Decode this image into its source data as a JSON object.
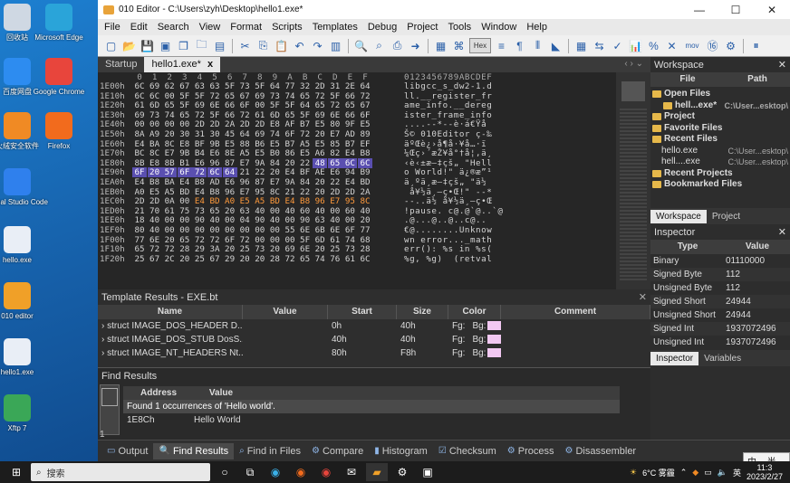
{
  "desktop": {
    "icons": [
      {
        "label": "回收站",
        "color": "#cfd8e3"
      },
      {
        "label": "Microsoft Edge",
        "color": "#2aa4d9"
      },
      {
        "label": "百度网盘",
        "color": "#2d8cf0"
      },
      {
        "label": "Google Chrome",
        "color": "#e8453c"
      },
      {
        "label": "火绒安全软件",
        "color": "#f08a24"
      },
      {
        "label": "Firefox",
        "color": "#f26b1d"
      },
      {
        "label": "Visual Studio Code",
        "color": "#2f80ed"
      },
      {
        "label": "hello.exe",
        "color": "#e9eef6"
      },
      {
        "label": "010 editor",
        "color": "#f0a028"
      },
      {
        "label": "hello1.exe",
        "color": "#e9eef6"
      },
      {
        "label": "Xftp 7",
        "color": "#3aa757"
      }
    ]
  },
  "window": {
    "title": "010 Editor - C:\\Users\\zyh\\Desktop\\hello1.exe*",
    "controls": [
      "—",
      "☐",
      "✕"
    ]
  },
  "menu": [
    "File",
    "Edit",
    "Search",
    "View",
    "Format",
    "Scripts",
    "Templates",
    "Debug",
    "Project",
    "Tools",
    "Window",
    "Help"
  ],
  "toolbar": {
    "hex_label": "Hex",
    "mov_label": "mov"
  },
  "tabs": {
    "startup": "Startup",
    "file": "hello1.exe*",
    "close": "x",
    "nav": "‹ ›  ⌄"
  },
  "hex": {
    "columns": [
      "0",
      "1",
      "2",
      "3",
      "4",
      "5",
      "6",
      "7",
      "8",
      "9",
      "A",
      "B",
      "C",
      "D",
      "E",
      "F"
    ],
    "ascii_header": "0123456789ABCDEF",
    "rows": [
      {
        "addr": "1E00h",
        "bytes": [
          "6C",
          "69",
          "62",
          "67",
          "63",
          "63",
          "5F",
          "73",
          "5F",
          "64",
          "77",
          "32",
          "2D",
          "31",
          "2E",
          "64"
        ],
        "ascii": "libgcc_s_dw2-1.d"
      },
      {
        "addr": "1E10h",
        "bytes": [
          "6C",
          "6C",
          "00",
          "5F",
          "5F",
          "72",
          "65",
          "67",
          "69",
          "73",
          "74",
          "65",
          "72",
          "5F",
          "66",
          "72"
        ],
        "ascii": "ll.__register_fr"
      },
      {
        "addr": "1E20h",
        "bytes": [
          "61",
          "6D",
          "65",
          "5F",
          "69",
          "6E",
          "66",
          "6F",
          "00",
          "5F",
          "5F",
          "64",
          "65",
          "72",
          "65",
          "67"
        ],
        "ascii": "ame_info.__dereg"
      },
      {
        "addr": "1E30h",
        "bytes": [
          "69",
          "73",
          "74",
          "65",
          "72",
          "5F",
          "66",
          "72",
          "61",
          "6D",
          "65",
          "5F",
          "69",
          "6E",
          "66",
          "6F"
        ],
        "ascii": "ister_frame_info"
      },
      {
        "addr": "1E40h",
        "bytes": [
          "00",
          "00",
          "00",
          "00",
          "2D",
          "2D",
          "2A",
          "2D",
          "2D",
          "E8",
          "AF",
          "B7",
          "E5",
          "80",
          "9F",
          "E5"
        ],
        "ascii": "....--*--è·á€Ÿå"
      },
      {
        "addr": "1E50h",
        "bytes": [
          "8A",
          "A9",
          "20",
          "30",
          "31",
          "30",
          "45",
          "64",
          "69",
          "74",
          "6F",
          "72",
          "20",
          "E7",
          "AD",
          "89"
        ],
        "ascii": "Š© 010Editor ç-‰"
      },
      {
        "addr": "1E60h",
        "bytes": [
          "E4",
          "BA",
          "8C",
          "E8",
          "BF",
          "9B",
          "E5",
          "88",
          "B6",
          "E5",
          "B7",
          "A5",
          "E5",
          "85",
          "B7",
          "EF"
        ],
        "ascii": "äºŒè¿›å¶å·¥å…·ï"
      },
      {
        "addr": "1E70h",
        "bytes": [
          "BC",
          "8C",
          "E7",
          "9B",
          "B4",
          "E6",
          "8E",
          "A5",
          "E5",
          "B0",
          "86",
          "E5",
          "A6",
          "82",
          "E4",
          "B8"
        ],
        "ascii": "¼Œç›´æŽ¥å°†å¦‚ä¸"
      },
      {
        "addr": "1E80h",
        "bytes": [
          "8B",
          "E8",
          "8B",
          "B1",
          "E6",
          "96",
          "87",
          "E7",
          "9A",
          "84",
          "20",
          "22",
          "48",
          "65",
          "6C",
          "6C"
        ],
        "ascii": "‹è‹±æ–‡çš„ \"Hell"
      },
      {
        "addr": "1E90h",
        "bytes": [
          "6F",
          "20",
          "57",
          "6F",
          "72",
          "6C",
          "64",
          "21",
          "22",
          "20",
          "E4",
          "BF",
          "AE",
          "E6",
          "94",
          "B9"
        ],
        "ascii": "o World!\" ä¿®æ”¹"
      },
      {
        "addr": "1EA0h",
        "bytes": [
          "E4",
          "B8",
          "BA",
          "E4",
          "B8",
          "AD",
          "E6",
          "96",
          "87",
          "E7",
          "9A",
          "84",
          "20",
          "22",
          "E4",
          "BD"
        ],
        "ascii": "ä¸ºä¸­æ–‡çš„ \"ä½"
      },
      {
        "addr": "1EB0h",
        "bytes": [
          "A0",
          "E5",
          "A5",
          "BD",
          "E4",
          "B8",
          "96",
          "E7",
          "95",
          "8C",
          "21",
          "22",
          "20",
          "2D",
          "2D",
          "2A"
        ],
        "ascii": " å¥½ä¸–ç•Œ!\" --*"
      },
      {
        "addr": "1EC0h",
        "bytes": [
          "2D",
          "2D",
          "0A",
          "00",
          "E4",
          "BD",
          "A0",
          "E5",
          "A5",
          "BD",
          "E4",
          "B8",
          "96",
          "E7",
          "95",
          "8C"
        ],
        "ascii": "--..ä½ å¥½ä¸–ç•Œ"
      },
      {
        "addr": "1ED0h",
        "bytes": [
          "21",
          "70",
          "61",
          "75",
          "73",
          "65",
          "20",
          "63",
          "40",
          "00",
          "40",
          "60",
          "40",
          "00",
          "60",
          "40"
        ],
        "ascii": "!pause. c@.@`@..`@"
      },
      {
        "addr": "1EE0h",
        "bytes": [
          "18",
          "40",
          "00",
          "00",
          "90",
          "40",
          "00",
          "04",
          "90",
          "40",
          "00",
          "90",
          "63",
          "40",
          "00",
          "20"
        ],
        "ascii": ".@...@..@..c@.. "
      },
      {
        "addr": "1EF0h",
        "bytes": [
          "80",
          "40",
          "00",
          "00",
          "00",
          "00",
          "00",
          "00",
          "00",
          "00",
          "55",
          "6E",
          "6B",
          "6E",
          "6F",
          "77"
        ],
        "ascii": "€@........Unknow"
      },
      {
        "addr": "1F00h",
        "bytes": [
          "77",
          "6E",
          "20",
          "65",
          "72",
          "72",
          "6F",
          "72",
          "00",
          "00",
          "00",
          "5F",
          "6D",
          "61",
          "74",
          "68"
        ],
        "ascii": "wn error..._math"
      },
      {
        "addr": "1F10h",
        "bytes": [
          "65",
          "72",
          "72",
          "28",
          "29",
          "3A",
          "20",
          "25",
          "73",
          "20",
          "69",
          "6E",
          "20",
          "25",
          "73",
          "28"
        ],
        "ascii": "err(): %s in %s("
      },
      {
        "addr": "1F20h",
        "bytes": [
          "25",
          "67",
          "2C",
          "20",
          "25",
          "67",
          "29",
          "20",
          "20",
          "28",
          "72",
          "65",
          "74",
          "76",
          "61",
          "6C"
        ],
        "ascii": "%g, %g)  (retval"
      }
    ]
  },
  "template_results": {
    "title": "Template Results - EXE.bt",
    "headers": [
      "Name",
      "Value",
      "Start",
      "Size",
      "Color",
      "Comment"
    ],
    "rows": [
      {
        "name": "struct IMAGE_DOS_HEADER D...",
        "value": "",
        "start": "0h",
        "size": "40h",
        "fg": "Fg:",
        "bg": "Bg:",
        "comment": ""
      },
      {
        "name": "struct IMAGE_DOS_STUB DosS...",
        "value": "",
        "start": "40h",
        "size": "40h",
        "fg": "Fg:",
        "bg": "Bg:",
        "comment": ""
      },
      {
        "name": "struct IMAGE_NT_HEADERS Nt...",
        "value": "",
        "start": "80h",
        "size": "F8h",
        "fg": "Fg:",
        "bg": "Bg:",
        "comment": ""
      }
    ]
  },
  "find_results": {
    "title": "Find Results",
    "headers": [
      "Address",
      "Value"
    ],
    "message": "Found 1 occurrences of 'Hello world'.",
    "rows": [
      {
        "address": "1E8Ch",
        "value": "Hello World"
      }
    ],
    "count": "1"
  },
  "bottom_tabs": [
    "Output",
    "Find Results",
    "Find in Files",
    "Compare",
    "Histogram",
    "Checksum",
    "Process",
    "Disassembler"
  ],
  "workspace": {
    "title": "Workspace",
    "headers": [
      "File",
      "Path"
    ],
    "rows": [
      {
        "label": "Open Files",
        "path": "",
        "bold": true,
        "indent": 0
      },
      {
        "label": "hell...exe*",
        "path": "C:\\User...esktop\\",
        "bold": true,
        "indent": 1
      },
      {
        "label": "Project",
        "path": "",
        "bold": true,
        "indent": 0
      },
      {
        "label": "Favorite Files",
        "path": "",
        "bold": true,
        "indent": 0
      },
      {
        "label": "Recent Files",
        "path": "",
        "bold": true,
        "indent": 0
      },
      {
        "label": "hello.exe",
        "path": "C:\\User...esktop\\",
        "bold": false,
        "indent": 1
      },
      {
        "label": "hell....exe",
        "path": "C:\\User...esktop\\",
        "bold": false,
        "indent": 1
      },
      {
        "label": "Recent Projects",
        "path": "",
        "bold": true,
        "indent": 0
      },
      {
        "label": "Bookmarked Files",
        "path": "",
        "bold": true,
        "indent": 0
      }
    ],
    "tabs": [
      "Workspace",
      "Project"
    ]
  },
  "inspector": {
    "title": "Inspector",
    "headers": [
      "Type",
      "Value"
    ],
    "rows": [
      {
        "type": "Binary",
        "value": "01110000"
      },
      {
        "type": "Signed Byte",
        "value": "112"
      },
      {
        "type": "Unsigned Byte",
        "value": "112"
      },
      {
        "type": "Signed Short",
        "value": "24944"
      },
      {
        "type": "Unsigned Short",
        "value": "24944"
      },
      {
        "type": "Signed Int",
        "value": "1937072496"
      },
      {
        "type": "Unsigned Int",
        "value": "1937072496"
      }
    ],
    "tabs": [
      "Inspector",
      "Variables"
    ]
  },
  "taskbar": {
    "search_placeholder": "搜索",
    "weather": "6°C 雾霾",
    "ime": "中 ·, 半 ⚙",
    "lang": "英",
    "time": "11:3",
    "date": "2023/2/27"
  }
}
